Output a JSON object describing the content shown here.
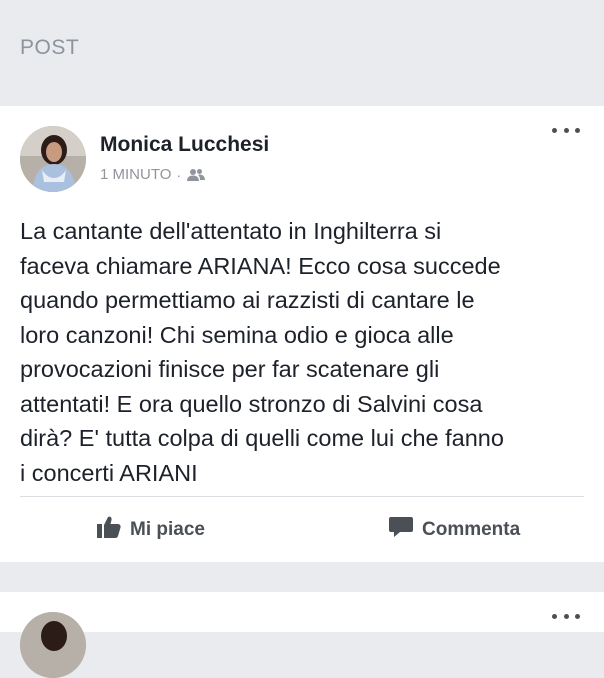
{
  "section": {
    "title": "POST"
  },
  "post": {
    "author": "Monica Lucchesi",
    "time": "1 MINUTO",
    "separator": "·",
    "audience_icon": "friends-icon",
    "text": "La cantante dell'attentato in Inghilterra si\nfaceva chiamare ARIANA! Ecco cosa succede\nquando permettiamo ai razzisti di cantare le\nloro canzoni! Chi semina odio e gioca alle\nprovocazioni finisce per far scatenare gli\nattentati! E ora quello stronzo di Salvini cosa\ndirà? E' tutta colpa di quelli come lui che fanno\ni concerti ARIANI",
    "actions": {
      "like_label": "Mi piace",
      "comment_label": "Commenta"
    }
  },
  "colors": {
    "background": "#e9ebee",
    "card": "#ffffff",
    "text": "#1d2129",
    "muted": "#90949c",
    "action": "#4b4f56"
  }
}
